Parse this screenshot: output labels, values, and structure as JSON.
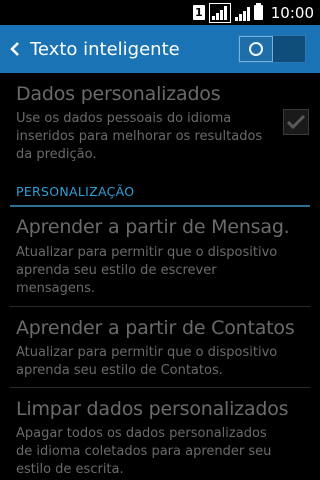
{
  "status_bar": {
    "sim_label": "1",
    "time": "10:00"
  },
  "action_bar": {
    "title": "Texto inteligente",
    "toggle_state": "on"
  },
  "settings": {
    "personalized_data": {
      "title": "Dados personalizados",
      "description": "Use os dados pessoais do idioma inseridos para melhorar os resultados da predição.",
      "checked": true
    },
    "section_header": "PERSONALIZAÇÃO",
    "items": [
      {
        "title": "Aprender a partir de Mensag.",
        "description": "Atualizar para permitir que o dispositivo aprenda seu estilo de escrever mensagens."
      },
      {
        "title": "Aprender a partir de Contatos",
        "description": "Atualizar para permitir que o dispositivo aprenda seu estilo de Contatos."
      },
      {
        "title": "Limpar dados personalizados",
        "description": "Apagar todos os dados personalizados de idioma coletados para aprender seu estilo de escrita."
      }
    ]
  },
  "colors": {
    "action_bar": "#1a73b5",
    "accent": "#2f9fd8",
    "disabled_text": "#6a6a6a"
  }
}
